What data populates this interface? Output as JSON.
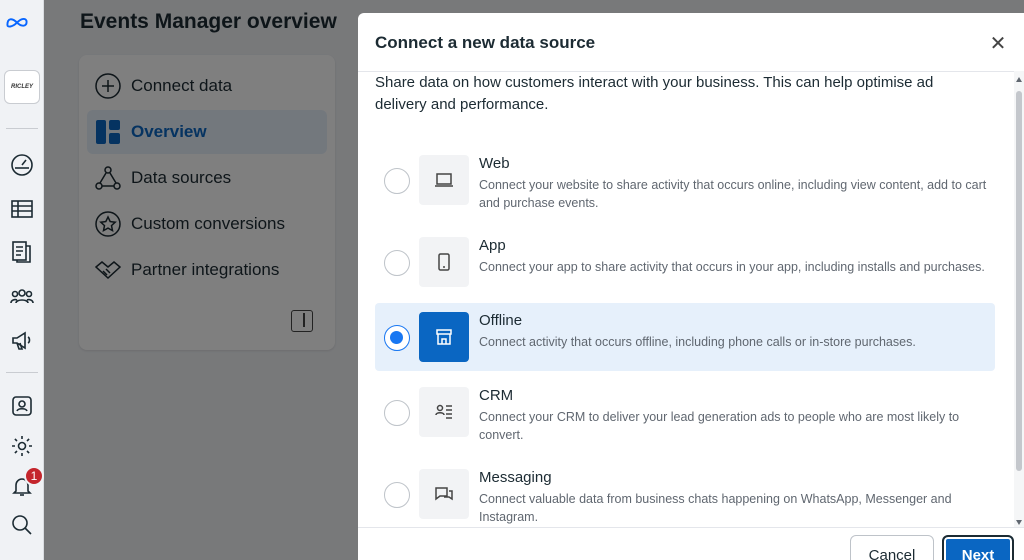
{
  "page": {
    "title": "Events Manager overview",
    "account_logo_text": "RICLEY"
  },
  "rail": {
    "notification_count": "1",
    "icons": [
      "meta-logo",
      "dashboard-icon",
      "table-icon",
      "pages-icon",
      "people-icon",
      "megaphone-icon",
      "id-card-icon",
      "gear-icon",
      "bell-icon",
      "search-icon"
    ]
  },
  "nav": {
    "items": [
      {
        "label": "Connect data",
        "icon": "plus-circle-icon"
      },
      {
        "label": "Overview",
        "icon": "layout-icon"
      },
      {
        "label": "Data sources",
        "icon": "nodes-icon"
      },
      {
        "label": "Custom conversions",
        "icon": "star-circle-icon"
      },
      {
        "label": "Partner integrations",
        "icon": "handshake-icon"
      }
    ],
    "active_index": 1
  },
  "dialog": {
    "title": "Connect a new data source",
    "description": "Share data on how customers interact with your business. This can help optimise ad delivery and performance.",
    "options": [
      {
        "title": "Web",
        "description": "Connect your website to share activity that occurs online, including view content, add to cart and purchase events.",
        "icon": "laptop-icon",
        "selected": false
      },
      {
        "title": "App",
        "description": "Connect your app to share activity that occurs in your app, including installs and purchases.",
        "icon": "phone-icon",
        "selected": false
      },
      {
        "title": "Offline",
        "description": "Connect activity that occurs offline, including phone calls or in-store purchases.",
        "icon": "store-icon",
        "selected": true
      },
      {
        "title": "CRM",
        "description": "Connect your CRM to deliver your lead generation ads to people who are most likely to convert.",
        "icon": "crm-icon",
        "selected": false
      },
      {
        "title": "Messaging",
        "description": "Connect valuable data from business chats happening on WhatsApp, Messenger and Instagram.",
        "icon": "chat-icon",
        "selected": false
      }
    ],
    "cancel_label": "Cancel",
    "next_label": "Next",
    "close_glyph": "✕"
  },
  "colors": {
    "accent": "#0a66c2",
    "radio_selected": "#1877f2",
    "selected_row_bg": "#e6f0fb",
    "badge": "#c4252c"
  }
}
